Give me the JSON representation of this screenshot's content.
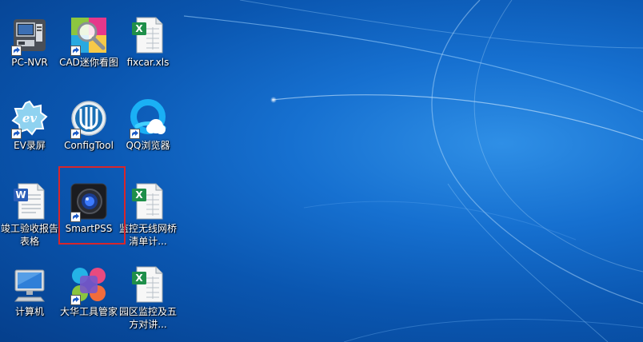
{
  "desktop": {
    "icons": [
      {
        "label": "PC-NVR",
        "icon": "pc-nvr-icon",
        "shortcut": true
      },
      {
        "label": "CAD迷你看图",
        "icon": "cad-viewer-icon",
        "shortcut": true
      },
      {
        "label": "fixcar.xls",
        "icon": "excel-file-icon",
        "shortcut": false
      },
      {
        "label": "EV录屏",
        "icon": "ev-recorder-icon",
        "shortcut": true
      },
      {
        "label": "ConfigTool",
        "icon": "config-tool-icon",
        "shortcut": true
      },
      {
        "label": "QQ浏览器",
        "icon": "qq-browser-icon",
        "shortcut": true
      },
      {
        "label": "竣工验收报告表格",
        "icon": "word-file-icon",
        "shortcut": false
      },
      {
        "label": "SmartPSS",
        "icon": "smartpss-icon",
        "shortcut": true
      },
      {
        "label": "监控无线网桥清单计...",
        "icon": "excel-file-icon",
        "shortcut": false
      },
      {
        "label": "计算机",
        "icon": "computer-icon",
        "shortcut": false
      },
      {
        "label": "大华工具管家",
        "icon": "dahua-toolbox-icon",
        "shortcut": true
      },
      {
        "label": "园区监控及五方对讲...",
        "icon": "excel-file-icon",
        "shortcut": false
      }
    ],
    "highlighted_icon": "SmartPSS",
    "highlight_color": "#d8262b"
  }
}
